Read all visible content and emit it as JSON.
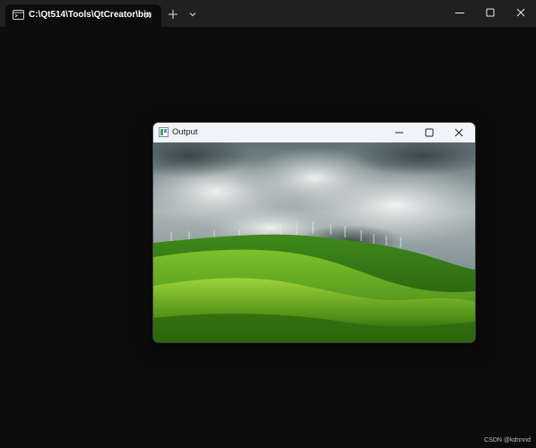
{
  "terminal": {
    "tab": {
      "title": "C:\\Qt514\\Tools\\QtCreator\\bin",
      "icon": "terminal-icon"
    },
    "controls": [
      "minimize-icon",
      "maximize-icon",
      "close-icon"
    ]
  },
  "output_window": {
    "title": "Output",
    "icon": "app-icon",
    "controls": [
      "minimize-icon",
      "maximize-icon",
      "close-icon"
    ],
    "image": "green rolling hills with wind turbines under a cloudy sky"
  },
  "watermark": "CSDN @kdnnnd",
  "colors": {
    "terminal_bg": "#0c0c0c",
    "titlebar_bg": "#202020",
    "output_titlebar_bg": "#f0f4f9"
  }
}
